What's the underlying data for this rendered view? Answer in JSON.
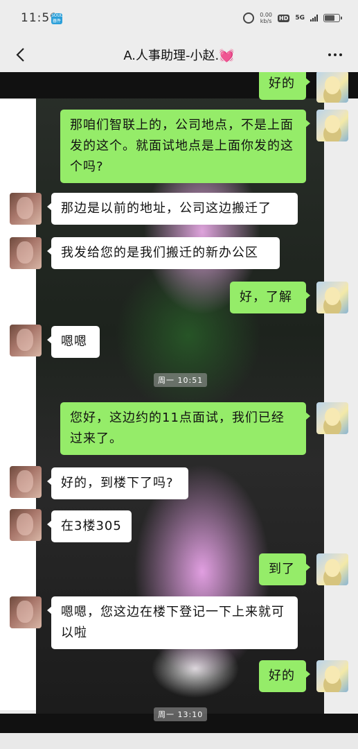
{
  "status_bar": {
    "time": "11:59",
    "app_badge": "SOUL 器件",
    "net_speed_value": "0.00",
    "net_speed_unit": "kb/s",
    "hd_label": "HD",
    "network_type": "5G"
  },
  "nav": {
    "title": "A.人事助理-小赵.💓"
  },
  "messages": [
    {
      "sender": "self",
      "text": "好的"
    },
    {
      "sender": "self",
      "text": "那咱们智联上的，公司地点，不是上面发的这个。就面试地点是上面你发的这个吗?"
    },
    {
      "sender": "other",
      "text": "那边是以前的地址，公司这边搬迁了"
    },
    {
      "sender": "other",
      "text": "我发给您的是我们搬迁的新办公区"
    },
    {
      "sender": "self",
      "text": "好，了解"
    },
    {
      "sender": "other",
      "text": "嗯嗯"
    },
    {
      "sender": "self",
      "text": "您好，这边约的11点面试，我们已经过来了。"
    },
    {
      "sender": "other",
      "text": "好的，到楼下了吗?"
    },
    {
      "sender": "other",
      "text": "在3楼305"
    },
    {
      "sender": "self",
      "text": "到了"
    },
    {
      "sender": "other",
      "text": "嗯嗯，您这边在楼下登记一下上来就可以啦"
    },
    {
      "sender": "self",
      "text": "好的"
    }
  ],
  "timestamps": [
    "周一 10:51",
    "周一 13:10"
  ],
  "colors": {
    "self_bubble": "#95ec69",
    "other_bubble": "#ffffff",
    "background": "#ededed"
  }
}
